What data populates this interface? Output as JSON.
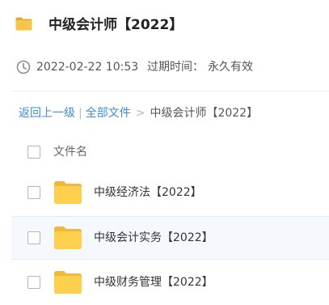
{
  "header": {
    "title": "中级会计师【2022】"
  },
  "meta": {
    "date": "2022-02-22 10:53",
    "expire_label": "过期时间：",
    "expire_value": "永久有效"
  },
  "breadcrumb": {
    "back": "返回上一级",
    "separator": "|",
    "all_files": "全部文件",
    "arrow": ">",
    "current": "中级会计师【2022】"
  },
  "table": {
    "column_name": "文件名",
    "rows": [
      {
        "name": "中级经济法【2022】"
      },
      {
        "name": "中级会计实务【2022】"
      },
      {
        "name": "中级财务管理【2022】"
      }
    ]
  },
  "colors": {
    "link": "#3b8cd4",
    "folder": "#f6c54a",
    "row_highlight": "#f5f8fd"
  }
}
